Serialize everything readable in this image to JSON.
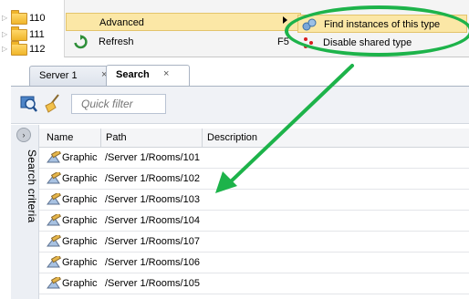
{
  "tree": {
    "nodes": [
      {
        "label": "110"
      },
      {
        "label": "111"
      },
      {
        "label": "112"
      }
    ]
  },
  "context_menu": {
    "advanced": {
      "label": "Advanced"
    },
    "refresh": {
      "label": "Refresh",
      "shortcut": "F5"
    },
    "submenu": [
      {
        "label": "Find instances of this type",
        "icon": "binoculars-icon"
      },
      {
        "label": "Disable shared type",
        "icon": "red-dots-icon"
      }
    ]
  },
  "tabs": [
    {
      "label": "Server 1",
      "close": "×"
    },
    {
      "label": "Search",
      "close": "×"
    }
  ],
  "toolbar": {
    "quick_filter_placeholder": "Quick filter"
  },
  "side_panel": {
    "label": "Search criteria"
  },
  "table": {
    "columns": [
      "Name",
      "Path",
      "Description"
    ],
    "rows": [
      {
        "name": "Graphic",
        "path": "/Server 1/Rooms/101"
      },
      {
        "name": "Graphic",
        "path": "/Server 1/Rooms/102"
      },
      {
        "name": "Graphic",
        "path": "/Server 1/Rooms/103"
      },
      {
        "name": "Graphic",
        "path": "/Server 1/Rooms/104"
      },
      {
        "name": "Graphic",
        "path": "/Server 1/Rooms/107"
      },
      {
        "name": "Graphic",
        "path": "/Server 1/Rooms/106"
      },
      {
        "name": "Graphic",
        "path": "/Server 1/Rooms/105"
      }
    ]
  },
  "colors": {
    "highlight": "#1db34a",
    "menu_hover": "#fbe7a6",
    "filter_text": "#2b5aa8"
  }
}
